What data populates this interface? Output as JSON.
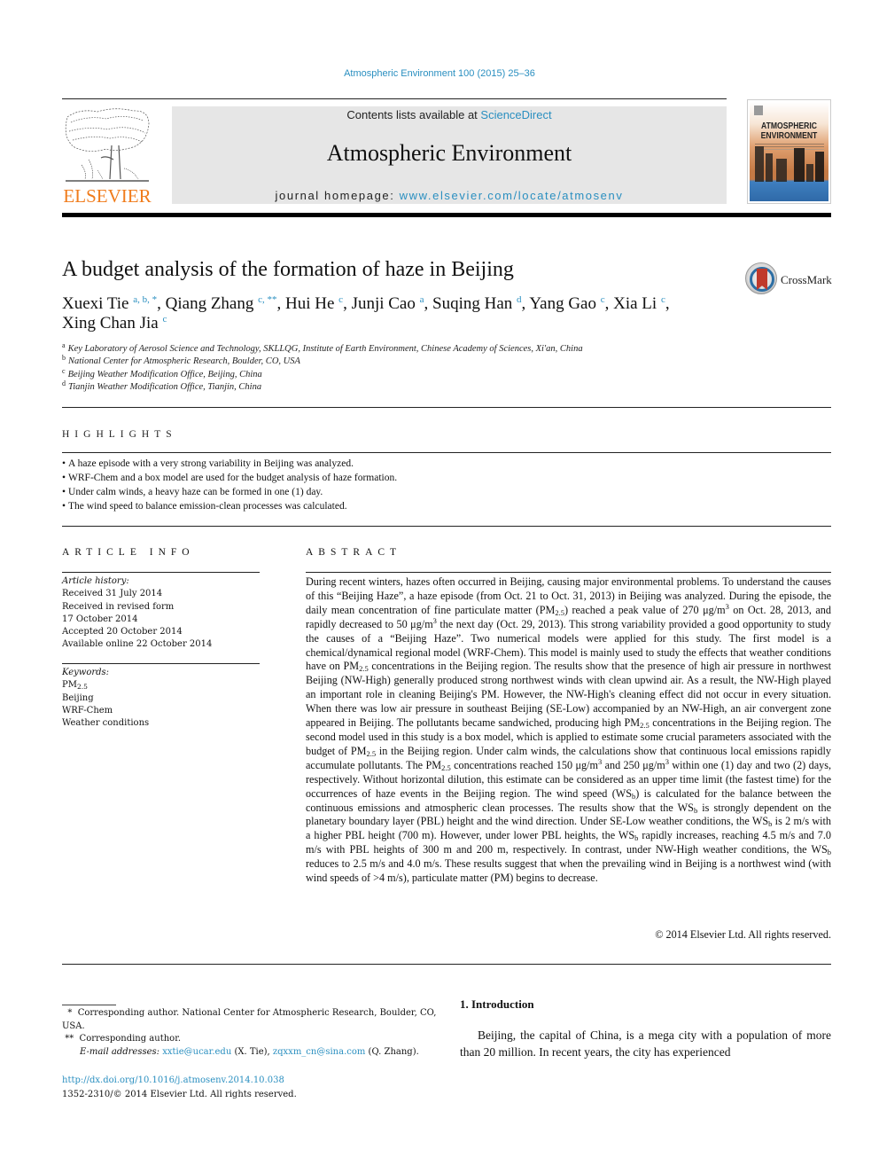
{
  "header": {
    "citation": "Atmospheric Environment 100 (2015) 25–36",
    "publisher_logo_text": "ELSEVIER",
    "contents_prefix": "Contents lists available at ",
    "contents_link": "ScienceDirect",
    "journal_title": "Atmospheric Environment",
    "homepage_prefix": "journal homepage: ",
    "homepage_link": "www.elsevier.com/locate/atmosenv",
    "cover_title_line1": "ATMOSPHERIC",
    "cover_title_line2": "ENVIRONMENT",
    "brand_orange": "#f07c1c",
    "link_color": "#2a8fc0"
  },
  "article": {
    "title": "A budget analysis of the formation of haze in Beijing",
    "crossmark_label": "CrossMark",
    "authors": [
      {
        "name": "Xuexi Tie",
        "marks": "a, b, *"
      },
      {
        "name": "Qiang Zhang",
        "marks": "c, **"
      },
      {
        "name": "Hui He",
        "marks": "c"
      },
      {
        "name": "Junji Cao",
        "marks": "a"
      },
      {
        "name": "Suqing Han",
        "marks": "d"
      },
      {
        "name": "Yang Gao",
        "marks": "c"
      },
      {
        "name": "Xia Li",
        "marks": "c"
      },
      {
        "name": "Xing Chan Jia",
        "marks": "c"
      }
    ],
    "affiliations": [
      {
        "mark": "a",
        "text": "Key Laboratory of Aerosol Science and Technology, SKLLQG, Institute of Earth Environment, Chinese Academy of Sciences, Xi'an, China"
      },
      {
        "mark": "b",
        "text": "National Center for Atmospheric Research, Boulder, CO, USA"
      },
      {
        "mark": "c",
        "text": "Beijing Weather Modification Office, Beijing, China"
      },
      {
        "mark": "d",
        "text": "Tianjin Weather Modification Office, Tianjin, China"
      }
    ]
  },
  "highlights": {
    "heading": "HIGHLIGHTS",
    "items": [
      "A haze episode with a very strong variability in Beijing was analyzed.",
      "WRF-Chem and a box model are used for the budget analysis of haze formation.",
      "Under calm winds, a heavy haze can be formed in one (1) day.",
      "The wind speed to balance emission-clean processes was calculated."
    ]
  },
  "article_info": {
    "heading": "ARTICLE INFO",
    "history_label": "Article history:",
    "history": [
      "Received 31 July 2014",
      "Received in revised form",
      "17 October 2014",
      "Accepted 20 October 2014",
      "Available online 22 October 2014"
    ],
    "keywords_label": "Keywords:",
    "keyword_pm_base": "PM",
    "keyword_pm_sub": "2.5",
    "keywords": [
      "Beijing",
      "WRF-Chem",
      "Weather conditions"
    ]
  },
  "abstract": {
    "heading": "ABSTRACT",
    "segments": [
      "During recent winters, hazes often occurred in Beijing, causing major environmental problems. To understand the causes of this “Beijing Haze”, a haze episode (from Oct. 21 to Oct. 31, 2013) in Beijing was analyzed. During the episode, the daily mean concentration of fine particulate matter (PM",
      "2.5",
      ") reached a peak value of 270 μg/m",
      "3",
      " on Oct. 28, 2013, and rapidly decreased to 50 μg/m",
      "3",
      " the next day (Oct. 29, 2013). This strong variability provided a good opportunity to study the causes of a “Beijing Haze”. Two numerical models were applied for this study. The first model is a chemical/dynamical regional model (WRF-Chem). This model is mainly used to study the effects that weather conditions have on PM",
      "2.5",
      " concentrations in the Beijing region. The results show that the presence of high air pressure in northwest Beijing (NW-High) generally produced strong northwest winds with clean upwind air. As a result, the NW-High played an important role in cleaning Beijing's PM. However, the NW-High's cleaning effect did not occur in every situation. When there was low air pressure in southeast Beijing (SE-Low) accompanied by an NW-High, an air convergent zone appeared in Beijing. The pollutants became sandwiched, producing high PM",
      "2.5",
      " concentrations in the Beijing region. The second model used in this study is a box model, which is applied to estimate some crucial parameters associated with the budget of PM",
      "2.5",
      " in the Beijing region. Under calm winds, the calculations show that continuous local emissions rapidly accumulate pollutants. The PM",
      "2.5",
      " concentrations reached 150 μg/m",
      "3",
      " and 250 μg/m",
      "3",
      " within one (1) day and two (2) days, respectively. Without horizontal dilution, this estimate can be considered as an upper time limit (the fastest time) for the occurrences of haze events in the Beijing region. The wind speed (WS",
      "b",
      ") is calculated for the balance between the continuous emissions and atmospheric clean processes. The results show that the WS",
      "b",
      " is strongly dependent on the planetary boundary layer (PBL) height and the wind direction. Under SE-Low weather conditions, the WS",
      "b",
      " is 2 m/s with a higher PBL height (700 m). However, under lower PBL heights, the WS",
      "b",
      " rapidly increases, reaching 4.5 m/s and 7.0 m/s with PBL heights of 300 m and 200 m, respectively. In contrast, under NW-High weather conditions, the WS",
      "b",
      " reduces to 2.5 m/s and 4.0 m/s. These results suggest that when the prevailing wind in Beijing is a northwest wind (with wind speeds of >4 m/s), particulate matter (PM) begins to decrease."
    ],
    "copyright": "© 2014 Elsevier Ltd. All rights reserved."
  },
  "footnotes": {
    "note1_mark": "*",
    "note1_text": "Corresponding author. National Center for Atmospheric Research, Boulder, CO, USA.",
    "note2_mark": "**",
    "note2_text": "Corresponding author.",
    "email_label": "E-mail addresses:",
    "email1": "xxtie@ucar.edu",
    "email1_owner": " (X. Tie), ",
    "email2": "zqxxm_cn@sina.com",
    "email2_owner": " (Q. Zhang).",
    "doi": "http://dx.doi.org/10.1016/j.atmosenv.2014.10.038",
    "issn_copyright": "1352-2310/© 2014 Elsevier Ltd. All rights reserved."
  },
  "introduction": {
    "heading": "1.  Introduction",
    "text": "Beijing, the capital of China, is a mega city with a population of more than 20 million. In recent years, the city has experienced"
  }
}
